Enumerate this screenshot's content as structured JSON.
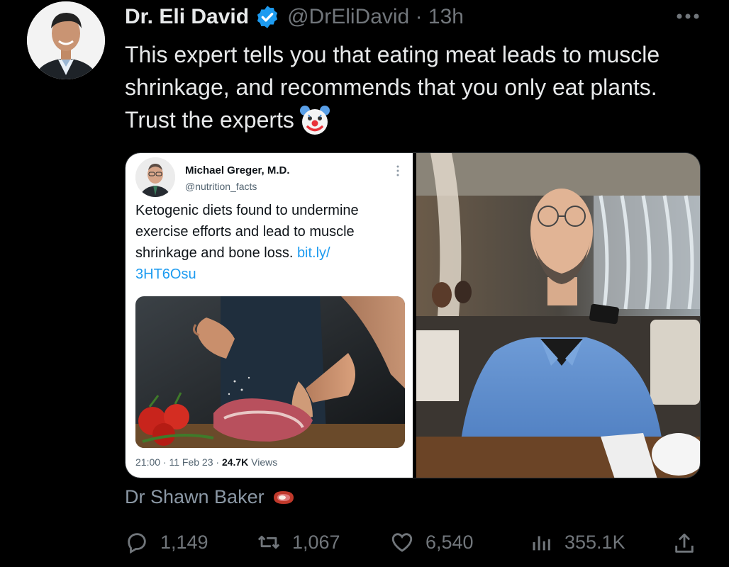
{
  "tweet": {
    "author_name": "Dr. Eli David",
    "handle": "@DrEliDavid",
    "time": "13h",
    "text": "This expert tells you that eating meat leads to muscle shrinkage, and recommends that you only eat plants. Trust the experts",
    "emoji_icon": "clown-face-icon"
  },
  "quoted_screenshot": {
    "author_name": "Michael Greger, M.D.",
    "handle": "@nutrition_facts",
    "text": "Ketogenic diets found to undermine exercise efforts and lead to muscle shrinkage and bone loss.",
    "link": "bit.ly/\n3HT6Osu",
    "timestamp": "21:00 · 11 Feb 23 · ",
    "views_count": "24.7K",
    "views_label": " Views"
  },
  "caption": {
    "text": "Dr Shawn Baker",
    "emoji_icon": "steak-icon"
  },
  "actions": {
    "replies": "1,149",
    "retweets": "1,067",
    "likes": "6,540",
    "views": "355.1K"
  },
  "colors": {
    "background": "#000000",
    "text": "#e7e9ea",
    "muted": "#71767b",
    "verified": "#1d9bf0",
    "link": "#1d9bf0"
  }
}
